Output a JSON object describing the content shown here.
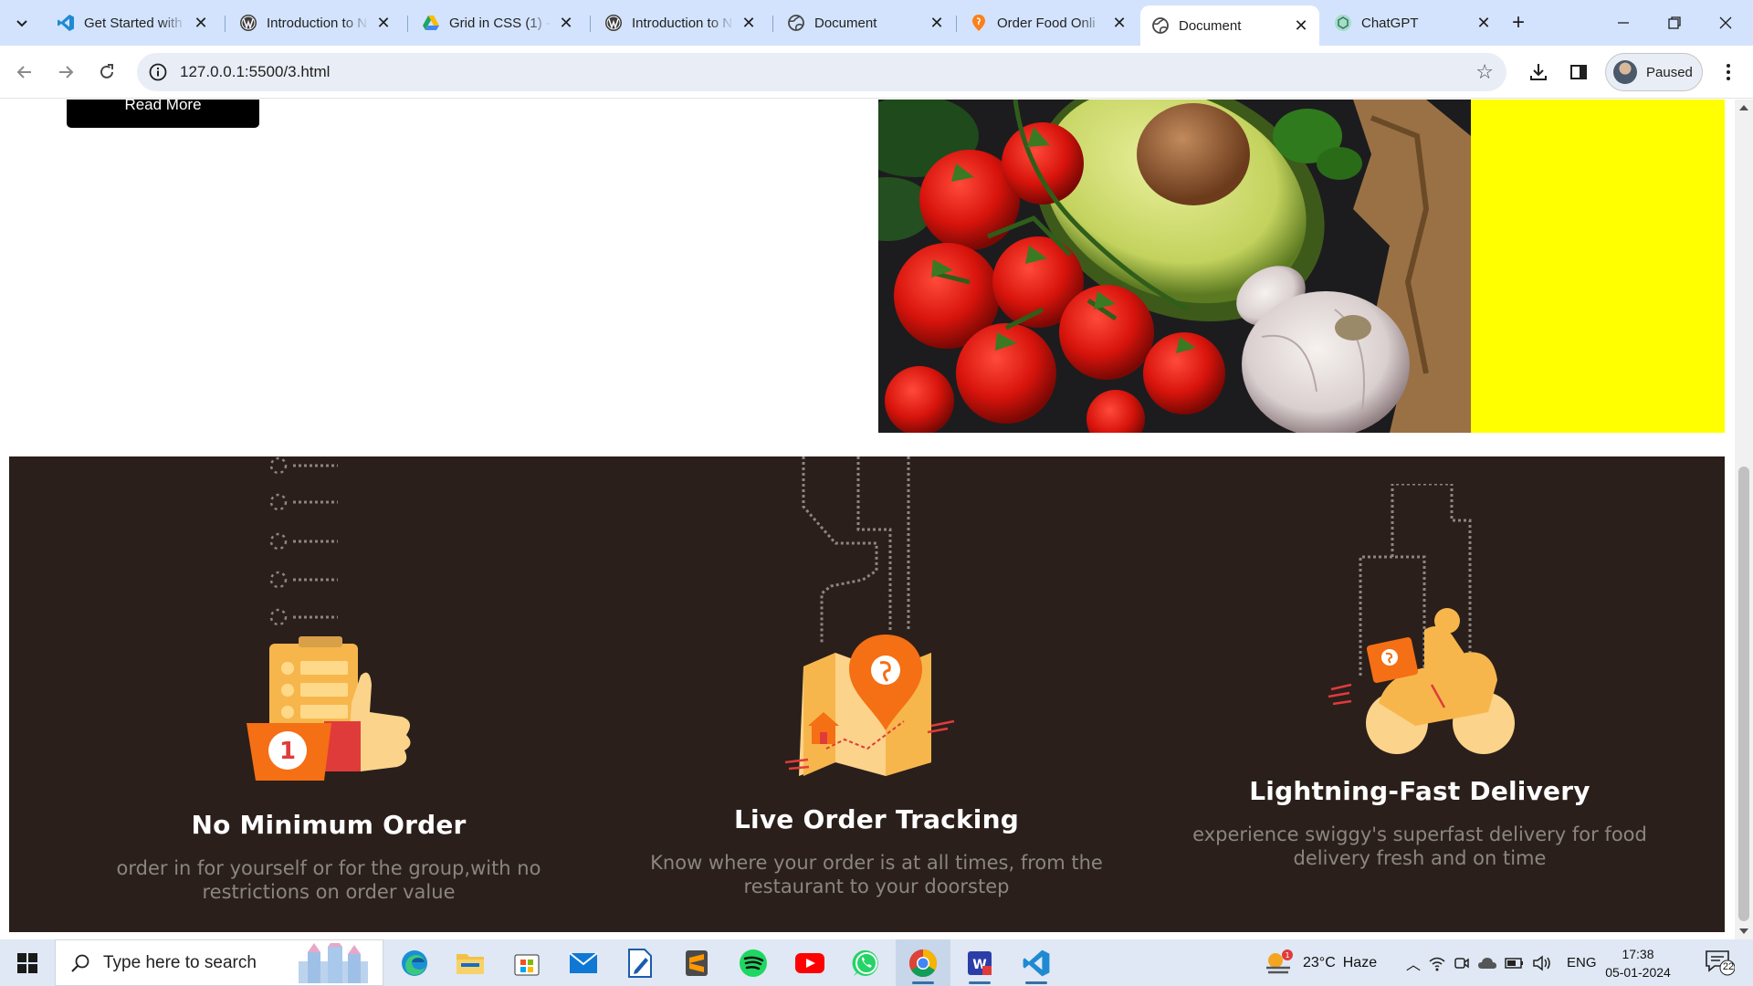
{
  "browser": {
    "tabs": [
      {
        "title": "Get Started with",
        "favicon": "vscode-icon",
        "active": false
      },
      {
        "title": "Introduction to N",
        "favicon": "wordpress-icon",
        "active": false
      },
      {
        "title": "Grid in CSS (1) - ",
        "favicon": "google-drive-icon",
        "active": false
      },
      {
        "title": "Introduction to N",
        "favicon": "wordpress-icon",
        "active": false
      },
      {
        "title": "Document",
        "favicon": "globe-icon",
        "active": false
      },
      {
        "title": "Order Food Onli",
        "favicon": "swiggy-icon",
        "active": false
      },
      {
        "title": "Document",
        "favicon": "globe-icon",
        "active": true
      },
      {
        "title": "ChatGPT",
        "favicon": "chatgpt-icon",
        "active": false
      }
    ],
    "url": "127.0.0.1:5500/3.html",
    "profile_label": "Paused"
  },
  "page": {
    "read_more_label": "Read More",
    "accent_yellow": "#ffff00",
    "features_bg": "#2a1f1b",
    "features": [
      {
        "title": "No Minimum Order",
        "desc_line1": "order in for yourself or for the group,with no",
        "desc_line2": "restrictions on order value",
        "icon": "thumbs-up-order-icon"
      },
      {
        "title": "Live Order Tracking",
        "desc_line1": "Know where your order is at all times, from the",
        "desc_line2": "restaurant to your doorstep",
        "icon": "map-pin-tracking-icon"
      },
      {
        "title": "Lightning-Fast Delivery",
        "desc_line1": "experience swiggy's superfast delivery for food",
        "desc_line2": "delivery fresh and on time",
        "icon": "delivery-scooter-icon"
      }
    ]
  },
  "taskbar": {
    "search_placeholder": "Type here to search",
    "weather_temp": "23°C",
    "weather_desc": "Haze",
    "weather_badge": "1",
    "language": "ENG",
    "time": "17:38",
    "date": "05-01-2024",
    "notification_count": "22"
  }
}
